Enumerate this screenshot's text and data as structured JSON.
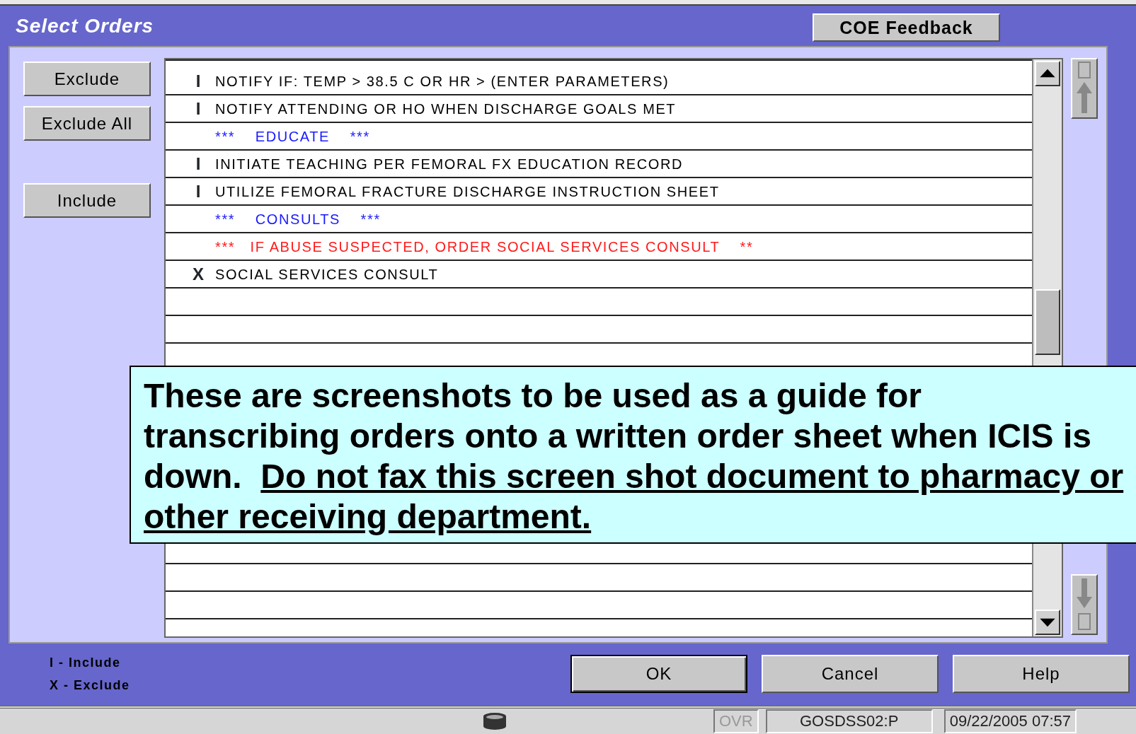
{
  "window": {
    "title": "Select Orders"
  },
  "header_button": "COE Feedback",
  "side_buttons": [
    "Exclude",
    "Exclude All",
    "Include"
  ],
  "orders": [
    {
      "kind": "order",
      "marker": "I",
      "text": "NOTIFY IF: TEMP > 38.5 C OR HR > (ENTER PARAMETERS)"
    },
    {
      "kind": "order",
      "marker": "I",
      "text": "NOTIFY ATTENDING OR HO WHEN DISCHARGE GOALS MET"
    },
    {
      "kind": "section",
      "text": "***    EDUCATE    ***"
    },
    {
      "kind": "order",
      "marker": "I",
      "text": "INITIATE TEACHING PER FEMORAL FX EDUCATION RECORD"
    },
    {
      "kind": "order",
      "marker": "I",
      "text": "UTILIZE FEMORAL FRACTURE DISCHARGE INSTRUCTION SHEET"
    },
    {
      "kind": "section",
      "text": "***    CONSULTS    ***"
    },
    {
      "kind": "alert",
      "text": "***   IF ABUSE SUSPECTED, ORDER SOCIAL SERVICES CONSULT    **"
    },
    {
      "kind": "order",
      "marker": "X",
      "text": "SOCIAL SERVICES CONSULT"
    }
  ],
  "legend": [
    "I - Include",
    "X - Exclude"
  ],
  "footer_buttons": [
    "OK",
    "Cancel",
    "Help"
  ],
  "status_bar": {
    "mode": "OVR",
    "session": "GOSDSS02:P",
    "datetime": "09/22/2005 07:57"
  },
  "callout": {
    "text": "These are screenshots to be used as a guide for transcribing orders onto a written order sheet when ICIS is down.  ",
    "underlined_text": "Do not fax this screen shot document to pharmacy or other receiving department."
  }
}
